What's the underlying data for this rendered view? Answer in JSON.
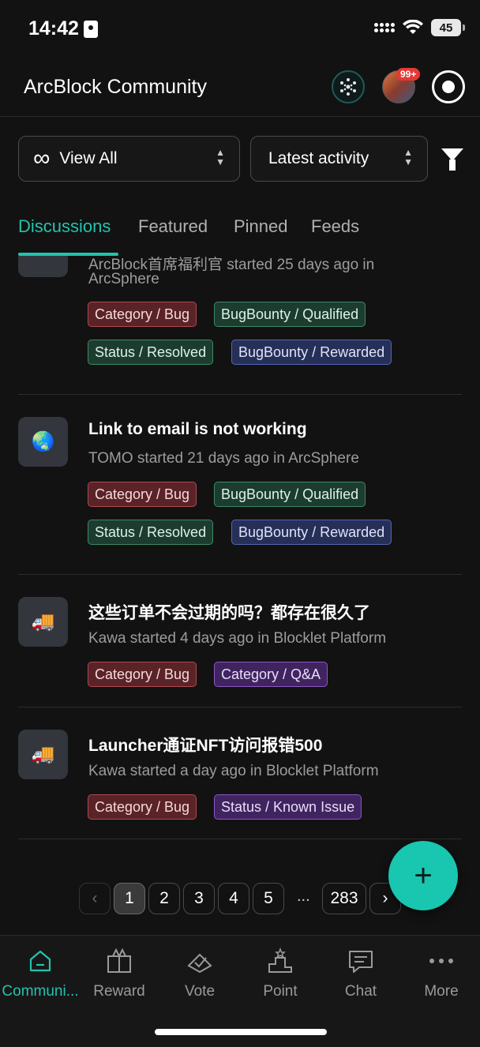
{
  "status_bar": {
    "time": "14:42",
    "battery": "45"
  },
  "header": {
    "title": "ArcBlock Community",
    "notification_badge": "99+"
  },
  "filters": {
    "view": "View All",
    "sort": "Latest activity"
  },
  "tabs": [
    {
      "label": "Discussions",
      "active": true
    },
    {
      "label": "Featured",
      "active": false
    },
    {
      "label": "Pinned",
      "active": false
    },
    {
      "label": "Feeds",
      "active": false
    }
  ],
  "posts": [
    {
      "icon": "",
      "title": "",
      "meta_line1": "ArcBlock首席福利官 started 25 days ago in",
      "meta_line2": "ArcSphere",
      "tags": [
        "Category / Bug",
        "BugBounty / Qualified",
        "Status / Resolved",
        "BugBounty / Rewarded"
      ]
    },
    {
      "icon": "🌏",
      "title": "Link to email is not working",
      "meta": "TOMO started 21 days ago in ArcSphere",
      "tags": [
        "Category / Bug",
        "BugBounty / Qualified",
        "Status / Resolved",
        "BugBounty / Rewarded"
      ]
    },
    {
      "icon": "🚚",
      "title": "这些订单不会过期的吗？都存在很久了",
      "meta": "Kawa started 4 days ago in Blocklet Platform",
      "tags": [
        "Category / Bug",
        "Category / Q&A"
      ]
    },
    {
      "icon": "🚚",
      "title": "Launcher通证NFT访问报错500",
      "meta": "Kawa started a day ago in Blocklet Platform",
      "tags": [
        "Category / Bug",
        "Status / Known Issue"
      ]
    }
  ],
  "pagination": {
    "pages": [
      "1",
      "2",
      "3",
      "4",
      "5"
    ],
    "ellipsis": "...",
    "last": "283",
    "current": "1"
  },
  "fab": {
    "label": "+"
  },
  "bottom_nav": [
    {
      "label": "Communi...",
      "icon": "home-icon",
      "active": true
    },
    {
      "label": "Reward",
      "icon": "gift-icon",
      "active": false
    },
    {
      "label": "Vote",
      "icon": "vote-icon",
      "active": false
    },
    {
      "label": "Point",
      "icon": "podium-icon",
      "active": false
    },
    {
      "label": "Chat",
      "icon": "chat-icon",
      "active": false
    },
    {
      "label": "More",
      "icon": "more-icon",
      "active": false
    }
  ],
  "colors": {
    "accent": "#23c3ad",
    "fab": "#19c6b0",
    "background": "#121212"
  }
}
